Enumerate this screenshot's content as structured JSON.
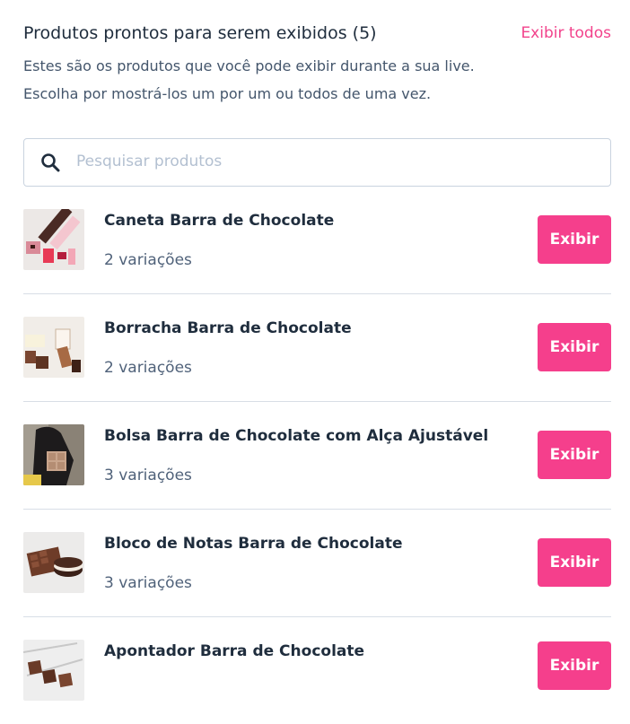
{
  "header": {
    "title": "Produtos prontos para serem exibidos (5)",
    "show_all_label": "Exibir todos",
    "description_line1": "Estes são os produtos que você pode exibir durante a sua live.",
    "description_line2": "Escolha por mostrá-los um por um ou todos de uma vez."
  },
  "search": {
    "placeholder": "Pesquisar produtos",
    "value": "",
    "icon": "search-icon"
  },
  "products": [
    {
      "name": "Caneta Barra de Chocolate",
      "variations": "2 variações",
      "button_label": "Exibir"
    },
    {
      "name": "Borracha Barra de Chocolate",
      "variations": "2 variações",
      "button_label": "Exibir"
    },
    {
      "name": "Bolsa Barra de Chocolate com Alça Ajustável",
      "variations": "3 variações",
      "button_label": "Exibir"
    },
    {
      "name": "Bloco de Notas Barra de Chocolate",
      "variations": "3 variações",
      "button_label": "Exibir"
    },
    {
      "name": "Apontador Barra de Chocolate",
      "variations": "",
      "button_label": "Exibir"
    }
  ],
  "colors": {
    "accent": "#f53f8c",
    "link": "#f2438c",
    "text": "#1f2d3d",
    "muted": "#50627a",
    "divider": "#d8dee6"
  }
}
